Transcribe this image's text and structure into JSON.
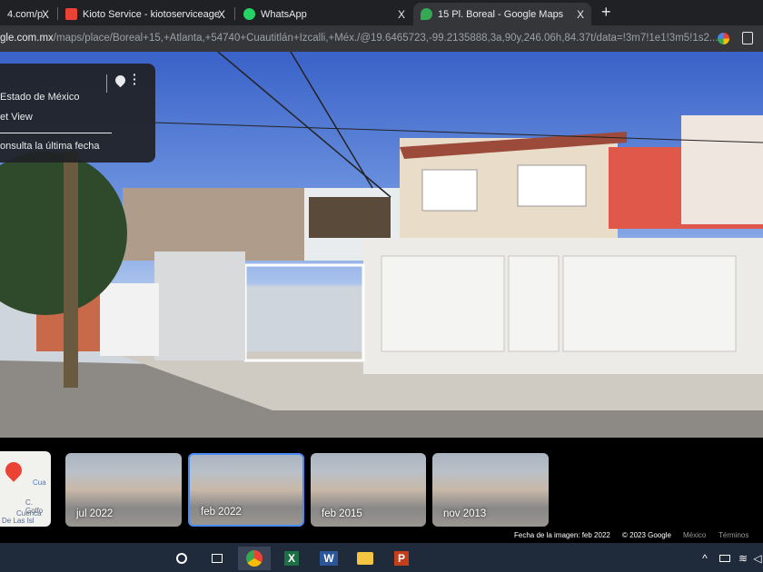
{
  "tabs": [
    {
      "title": "4.com/p",
      "close": "X"
    },
    {
      "title": "Kioto Service - kiotoserviceagenc",
      "close": "X"
    },
    {
      "title": "WhatsApp",
      "close": "X"
    },
    {
      "title": "15 Pl. Boreal - Google Maps",
      "close": "X"
    }
  ],
  "new_tab": "+",
  "address": {
    "host": "gle.com.mx",
    "path": "/maps/place/Boreal+15,+Atlanta,+54740+Cuautitlán+Izcalli,+Méx./@19.6465723,-99.2135888,3a,90y,246.06h,84.37t/data=!3m7!1e1!3m5!1s2..."
  },
  "panel": {
    "region": "Estado de México",
    "source": "et View",
    "latest_link": "onsulta la última fecha"
  },
  "thumbnails": [
    {
      "label": "jul 2022",
      "selected": false
    },
    {
      "label": "feb 2022",
      "selected": true
    },
    {
      "label": "feb 2015",
      "selected": false
    },
    {
      "label": "nov 2013",
      "selected": false
    }
  ],
  "map_thumb": {
    "labels": [
      "Cua",
      "C. Golfo",
      "Cuenca",
      "De Las Isl"
    ]
  },
  "footer": {
    "date": "Fecha de la imagen: feb 2022",
    "copyright": "© 2023 Google",
    "country": "México",
    "terms": "Términos"
  },
  "taskbar": {
    "apps": [
      "search",
      "task-view",
      "chrome",
      "excel",
      "word",
      "explorer",
      "powerpoint"
    ],
    "word_letter": "W",
    "excel_letter": "X",
    "ppt_letter": "P"
  }
}
